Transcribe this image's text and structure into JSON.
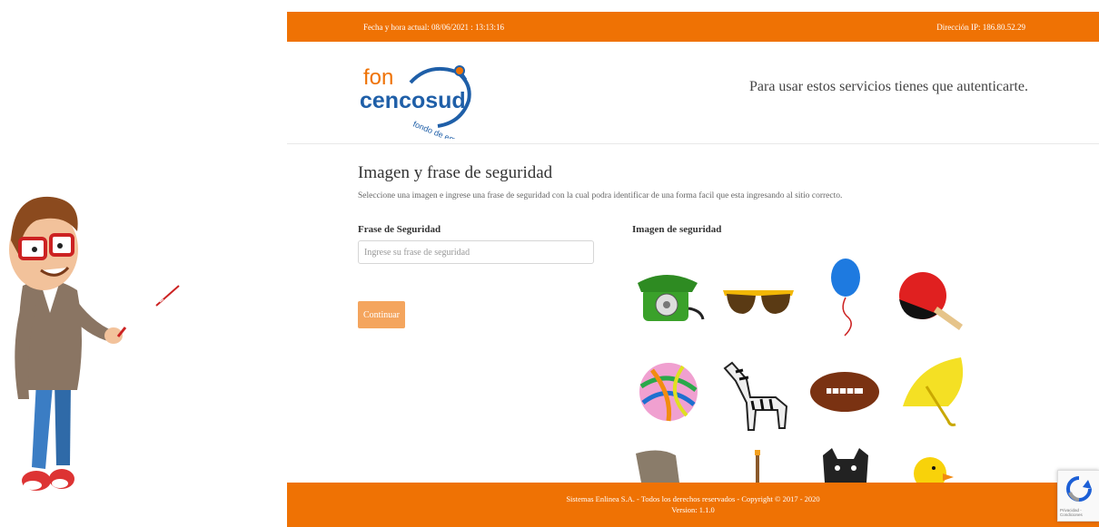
{
  "topbar": {
    "datetime": "Fecha y hora actual: 08/06/2021 : 13:13:16",
    "ip": "Dirección IP: 186.80.52.29"
  },
  "header": {
    "logo_line1": "fon",
    "logo_line2": "cencosud",
    "logo_tagline": "fondo de empleados",
    "auth_message": "Para usar estos servicios tienes que autenticarte."
  },
  "main": {
    "title": "Imagen y frase de seguridad",
    "subtitle": "Seleccione una imagen e ingrese una frase de seguridad con la cual podra identificar de una forma facil que esta ingresando al sitio correcto.",
    "phrase_label": "Frase de Seguridad",
    "phrase_placeholder": "Ingrese su frase de seguridad",
    "phrase_value": "",
    "continue_label": "Continuar",
    "image_label": "Imagen de seguridad",
    "images": [
      "telephone-icon",
      "sunglasses-icon",
      "balloon-icon",
      "ping-pong-paddle-icon",
      "yarn-ball-icon",
      "zebra-icon",
      "football-icon",
      "umbrella-icon",
      "elephant-icon",
      "guitar-icon",
      "bulldog-icon",
      "rubber-duck-icon"
    ]
  },
  "footer": {
    "line1": "Sistemas Enlinea S.A. - Todos los derechos reservados - Copyright © 2017 - 2020",
    "line2": "Version: 1.1.0"
  },
  "recaptcha": {
    "text": "Privacidad - Condiciones"
  },
  "colors": {
    "brand_orange": "#ef7204",
    "button_orange": "#f4a55e",
    "logo_blue": "#1f5fa8"
  }
}
